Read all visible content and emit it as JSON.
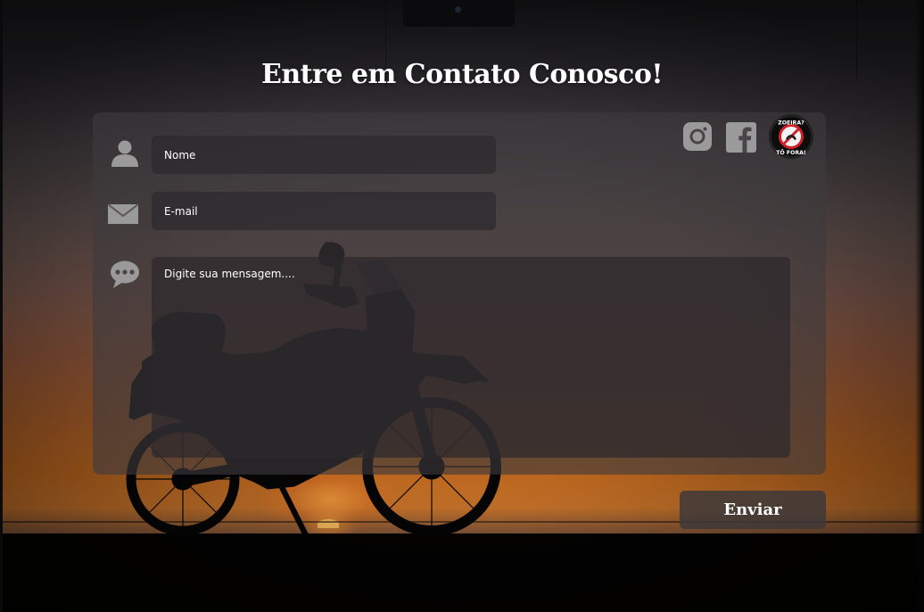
{
  "page": {
    "title": "Entre em Contato Conosco!"
  },
  "form": {
    "name_placeholder": "Nome",
    "email_placeholder": "E-mail",
    "message_placeholder": "Digite sua mensagem....",
    "submit_label": "Enviar"
  },
  "icons": {
    "name_field": "user-icon",
    "email_field": "envelope-icon",
    "message_field": "speech-bubble-icon",
    "social": [
      "instagram-icon",
      "facebook-icon"
    ],
    "badge": "zoeira-to-fora-badge"
  },
  "badge": {
    "text_top": "ZOEIRA?",
    "text_bottom": "TÔ FORA!"
  },
  "colors": {
    "panel_bg": "#3e3a3e",
    "input_bg": "#2c282c",
    "text": "#ffffff",
    "icon_gray": "#9a9a9a",
    "badge_red": "#d0202a"
  }
}
